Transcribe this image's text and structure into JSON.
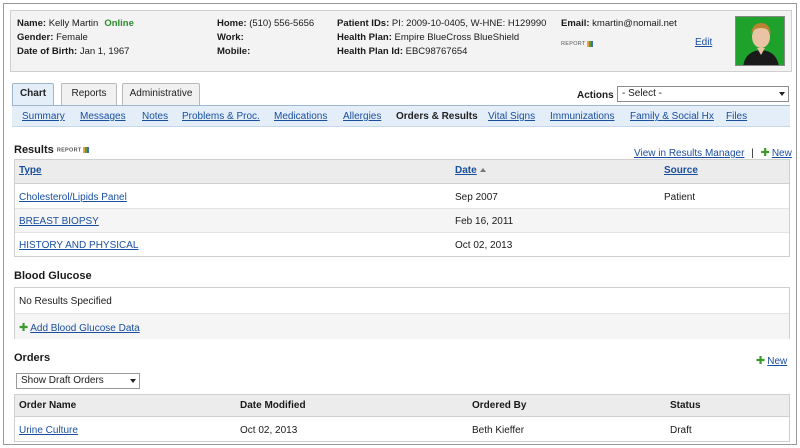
{
  "patient": {
    "name_label": "Name:",
    "name": "Kelly Martin",
    "status": "Online",
    "gender_label": "Gender:",
    "gender": "Female",
    "dob_label": "Date of Birth:",
    "dob": "Jan 1, 1967",
    "home_label": "Home:",
    "home": "(510) 556-5656",
    "work_label": "Work:",
    "mobile_label": "Mobile:",
    "ids_label": "Patient IDs:",
    "ids": "PI: 2009-10-0405, W-HNE: H129990",
    "plan_label": "Health Plan:",
    "plan": "Empire BlueCross BlueShield",
    "plan_id_label": "Health Plan Id:",
    "plan_id": "EBC98767654",
    "email_label": "Email:",
    "email": "kmartin@nomail.net",
    "report_badge": "REPORT",
    "edit": "Edit"
  },
  "tabs": [
    {
      "label": "Chart",
      "active": true
    },
    {
      "label": "Reports",
      "active": false
    },
    {
      "label": "Administrative",
      "active": false
    }
  ],
  "actions": {
    "label": "Actions",
    "selected": "- Select -"
  },
  "subnav": [
    "Summary",
    "Messages",
    "Notes",
    "Problems & Proc.",
    "Medications",
    "Allergies",
    "Orders & Results",
    "Vital Signs",
    "Immunizations",
    "Family & Social Hx",
    "Files"
  ],
  "subnav_current": "Orders & Results",
  "results": {
    "title": "Results",
    "badge": "REPORT",
    "view_manager": "View in Results Manager",
    "separator": "|",
    "new": "New",
    "columns": [
      "Type",
      "Date",
      "Source"
    ],
    "rows": [
      {
        "type": "Cholesterol/Lipids Panel",
        "date": "Sep 2007",
        "source": "Patient"
      },
      {
        "type": "BREAST BIOPSY",
        "date": "Feb 16, 2011",
        "source": ""
      },
      {
        "type": "HISTORY AND PHYSICAL",
        "date": "Oct 02, 2013",
        "source": ""
      }
    ]
  },
  "glucose": {
    "title": "Blood Glucose",
    "empty": "No Results Specified",
    "add": "Add Blood Glucose Data"
  },
  "orders": {
    "title": "Orders",
    "new": "New",
    "filter": "Show Draft Orders",
    "columns": [
      "Order Name",
      "Date Modified",
      "Ordered By",
      "Status"
    ],
    "rows": [
      {
        "name": "Urine Culture",
        "date": "Oct 02, 2013",
        "by": "Beth Kieffer",
        "status": "Draft"
      }
    ]
  },
  "colors": {
    "link": "#1a4fa0",
    "online": "#2e8b2e",
    "tab_active": "#e4eef8",
    "add_icon": "#3a9a2a"
  }
}
